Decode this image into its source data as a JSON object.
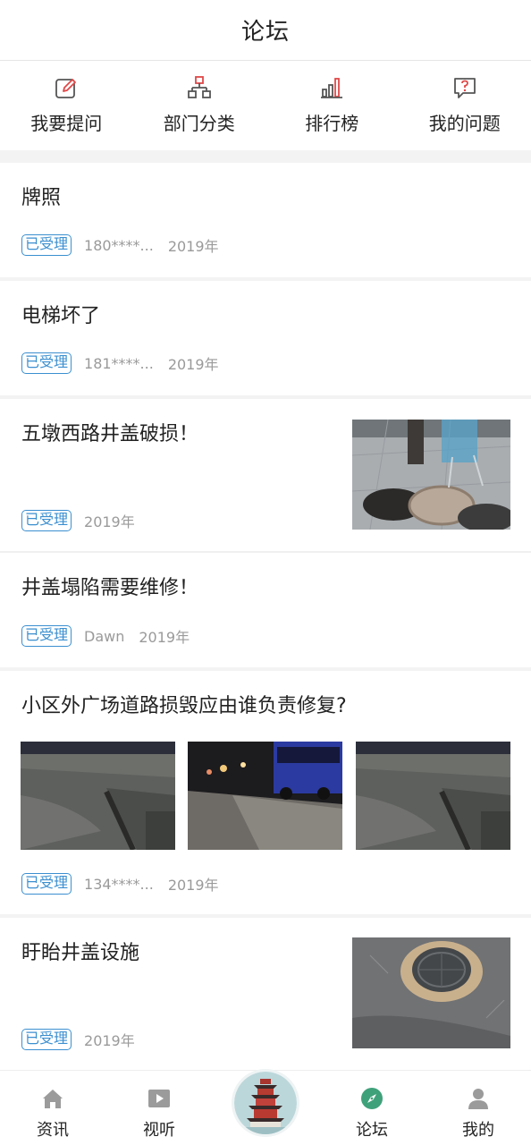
{
  "header": {
    "title": "论坛"
  },
  "quick_actions": [
    {
      "label": "我要提问",
      "icon": "edit-icon"
    },
    {
      "label": "部门分类",
      "icon": "org-chart-icon"
    },
    {
      "label": "排行榜",
      "icon": "bar-chart-icon"
    },
    {
      "label": "我的问题",
      "icon": "question-bubble-icon"
    }
  ],
  "posts": [
    {
      "title": "牌照",
      "status": "已受理",
      "user": "180****...",
      "date": "2019年"
    },
    {
      "title": "电梯坏了",
      "status": "已受理",
      "user": "181****...",
      "date": "2019年"
    },
    {
      "title": "五墩西路井盖破损！",
      "status": "已受理",
      "date": "2019年",
      "image": "manhole-cover-photo"
    },
    {
      "title": "井盖塌陷需要维修！",
      "status": "已受理",
      "user": "Dawn",
      "date": "2019年"
    },
    {
      "title": "小区外广场道路损毁应由谁负责修复?",
      "status": "已受理",
      "user": "134****...",
      "date": "2019年",
      "images": [
        "road-damage-photo",
        "road-night-bus-photo",
        "road-damage-photo"
      ]
    },
    {
      "title": "盱眙井盖设施",
      "status": "已受理",
      "date": "2019年",
      "image": "manhole-pothole-photo"
    }
  ],
  "tabbar": {
    "items": [
      {
        "label": "资讯",
        "icon": "home-icon"
      },
      {
        "label": "视听",
        "icon": "video-play-icon"
      },
      {
        "label": "",
        "icon": "tower-logo"
      },
      {
        "label": "论坛",
        "icon": "compass-icon"
      },
      {
        "label": "我的",
        "icon": "user-icon"
      }
    ],
    "active": "论坛"
  },
  "colors": {
    "badge": "#3b8fd0",
    "icon_red": "#e04848",
    "text": "#222222",
    "meta": "#9a9a9a",
    "forum_green": "#3fa17a"
  }
}
